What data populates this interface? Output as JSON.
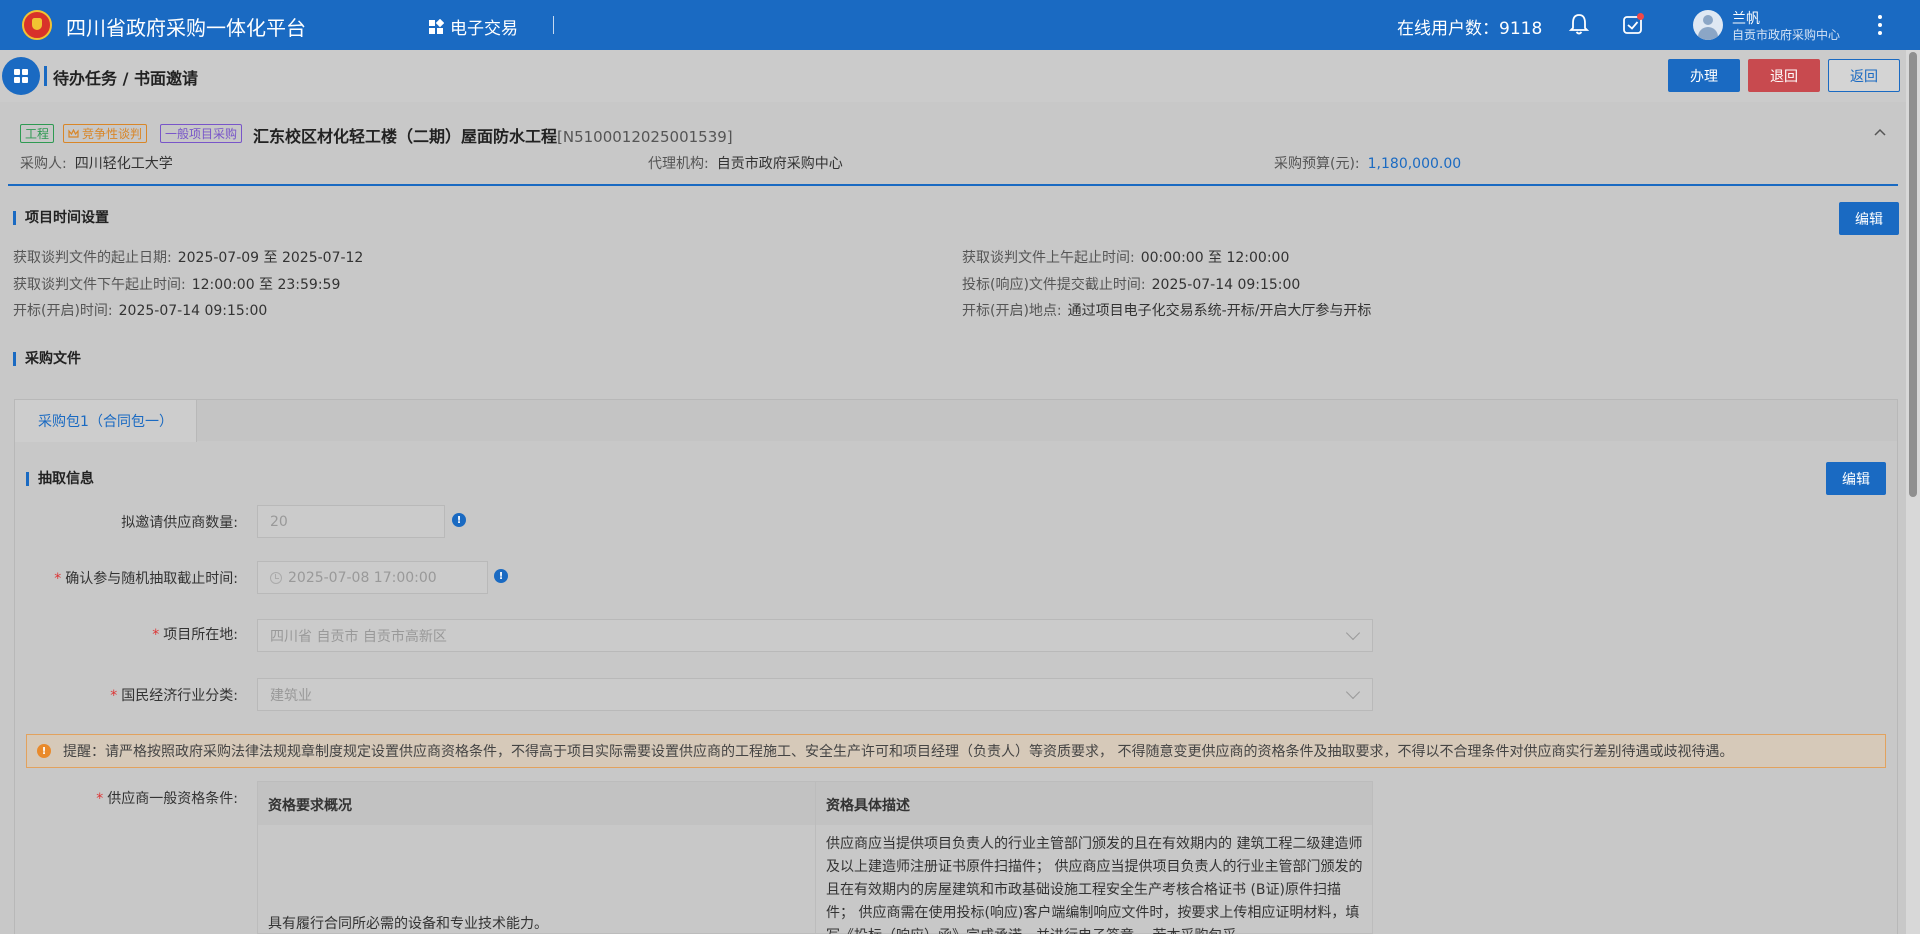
{
  "topbar": {
    "site_title": "四川省政府采购一体化平台",
    "nav_label": "电子交易",
    "online_label": "在线用户数：9118",
    "user_name": "兰帆",
    "user_org": "自贡市政府采购中心"
  },
  "header": {
    "breadcrumb": "待办任务 / 书面邀请",
    "btn_handle": "办理",
    "btn_return_back": "退回",
    "btn_back": "返回"
  },
  "project": {
    "tags": [
      "工程",
      "竞争性谈判",
      "一般项目采购"
    ],
    "title": "汇东校区材化轻工楼（二期）屋面防水工程",
    "code": "[N5100012025001539]",
    "purchaser_label": "采购人:",
    "purchaser": "四川轻化工大学",
    "agency_label": "代理机构:",
    "agency": "自贡市政府采购中心",
    "budget_label": "采购预算(元):",
    "budget": "1,180,000.00"
  },
  "time_section": {
    "title": "项目时间设置",
    "edit_label": "编辑",
    "items": [
      {
        "label": "获取谈判文件的起止日期:",
        "value": "2025-07-09 至 2025-07-12"
      },
      {
        "label": "获取谈判文件上午起止时间:",
        "value": "00:00:00 至 12:00:00"
      },
      {
        "label": "获取谈判文件下午起止时间:",
        "value": "12:00:00 至 23:59:59"
      },
      {
        "label": "投标(响应)文件提交截止时间:",
        "value": "2025-07-14 09:15:00"
      },
      {
        "label": "开标(开启)时间:",
        "value": "2025-07-14 09:15:00"
      },
      {
        "label": "开标(开启)地点:",
        "value": "通过项目电子化交易系统-开标/开启大厅参与开标"
      }
    ]
  },
  "docs_section": {
    "title": "采购文件"
  },
  "tabs": [
    {
      "label": "采购包1（合同包一）"
    }
  ],
  "extract": {
    "title": "抽取信息",
    "edit_label": "编辑",
    "supplier_count_label": "拟邀请供应商数量:",
    "supplier_count": "20",
    "deadline_label": "确认参与随机抽取截止时间:",
    "deadline": "2025-07-08 17:00:00",
    "location_label": "项目所在地:",
    "location": "四川省 自贡市 自贡市高新区",
    "industry_label": "国民经济行业分类:",
    "industry": "建筑业",
    "required_mark": "*"
  },
  "notice": "提醒：请严格按照政府采购法律法规规章制度规定设置供应商资格条件，不得高于项目实际需要设置供应商的工程施工、安全生产许可和项目经理（负责人）等资质要求， 不得随意变更供应商的资格条件及抽取要求，不得以不合理条件对供应商实行差别待遇或歧视待遇。",
  "qualification": {
    "label": "供应商一般资格条件:",
    "headers": [
      "资格要求概况",
      "资格具体描述"
    ],
    "rows": [
      {
        "summary": "具有履行合同所必需的设备和专业技术能力。",
        "detail": "供应商应当提供项目负责人的行业主管部门颁发的且在有效期内的 建筑工程二级建造师及以上建造师注册证书原件扫描件； 供应商应当提供项目负责人的行业主管部门颁发的且在有效期内的房屋建筑和市政基础设施工程安全生产考核合格证书 (B证)原件扫描件； 供应商需在使用投标(响应)客户端编制响应文件时，按要求上传相应证明材料，填写《投标（响应）函》完成承诺，并进行电子签章。 若本采购包采"
      }
    ]
  },
  "colors": {
    "primary": "#1a6ac2",
    "danger": "#c84a4f",
    "warning": "#e98a2b"
  }
}
